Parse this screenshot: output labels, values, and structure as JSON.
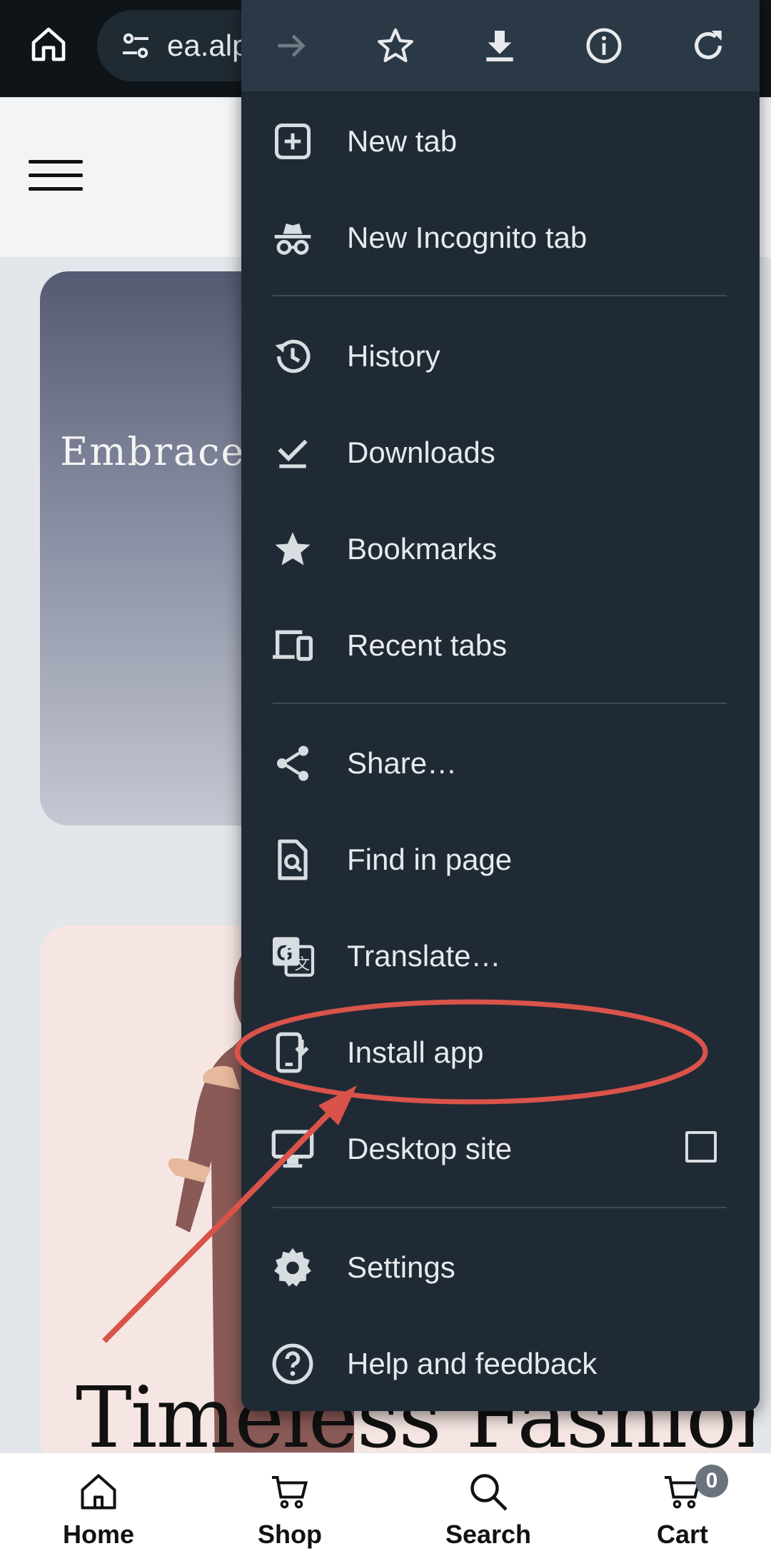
{
  "browser": {
    "url_text": "ea.alp",
    "toolbar_icons": [
      "forward-icon",
      "star-icon",
      "download-icon",
      "info-icon",
      "refresh-icon"
    ]
  },
  "page": {
    "hero1_text": "Embrace Your Look with",
    "hero2_title": "Timeless Fashion"
  },
  "menu": {
    "items": [
      {
        "label": "New tab",
        "icon": "new-tab-icon"
      },
      {
        "label": "New Incognito tab",
        "icon": "incognito-icon"
      },
      {
        "label": "History",
        "icon": "history-icon"
      },
      {
        "label": "Downloads",
        "icon": "downloads-icon"
      },
      {
        "label": "Bookmarks",
        "icon": "bookmarks-icon"
      },
      {
        "label": "Recent tabs",
        "icon": "recent-tabs-icon"
      },
      {
        "label": "Share…",
        "icon": "share-icon"
      },
      {
        "label": "Find in page",
        "icon": "find-in-page-icon"
      },
      {
        "label": "Translate…",
        "icon": "translate-icon"
      },
      {
        "label": "Install app",
        "icon": "install-app-icon"
      },
      {
        "label": "Desktop site",
        "icon": "desktop-site-icon",
        "checked": false
      },
      {
        "label": "Settings",
        "icon": "settings-icon"
      },
      {
        "label": "Help and feedback",
        "icon": "help-icon"
      }
    ]
  },
  "bottom_nav": {
    "items": [
      {
        "label": "Home",
        "icon": "home-icon"
      },
      {
        "label": "Shop",
        "icon": "shop-cart-icon"
      },
      {
        "label": "Search",
        "icon": "search-icon"
      },
      {
        "label": "Cart",
        "icon": "cart-icon"
      }
    ],
    "cart_count": "0"
  },
  "colors": {
    "menu_bg": "#202a35",
    "menu_toolbar_bg": "#2b3946",
    "annotation": "#d9534a"
  }
}
